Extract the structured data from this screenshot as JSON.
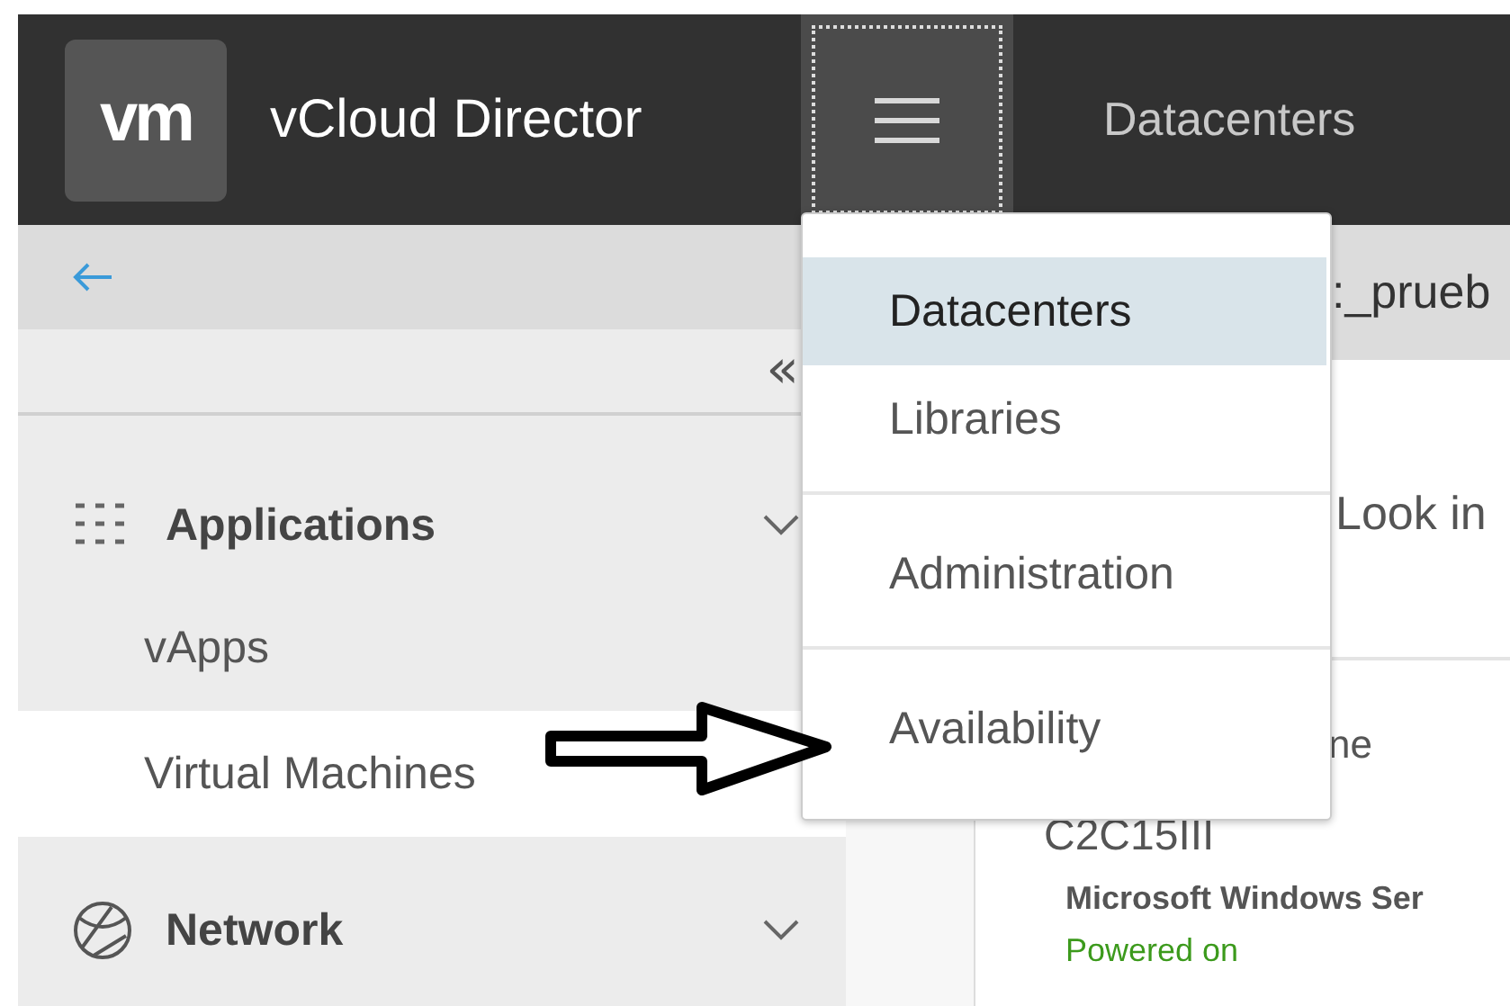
{
  "header": {
    "logo": "vm",
    "title": "vCloud Director",
    "menu_button": {
      "focused": true
    },
    "nav_link": "Datacenters"
  },
  "sidebar": {
    "collapse": "«",
    "groups": [
      {
        "label": "Applications",
        "items": [
          {
            "label": "vApps",
            "selected": false
          },
          {
            "label": "Virtual Machines",
            "selected": true
          }
        ]
      },
      {
        "label": "Network"
      }
    ]
  },
  "menu": {
    "sections": [
      [
        {
          "label": "Datacenters",
          "selected": true
        },
        {
          "label": "Libraries",
          "selected": false
        }
      ],
      [
        {
          "label": "Administration",
          "selected": false
        }
      ],
      [
        {
          "label": "Availability",
          "selected": false
        }
      ]
    ]
  },
  "content": {
    "breadcrumb": ":_prueb",
    "filter_text": "Look in",
    "column_label": "ne",
    "vm": {
      "name": "C2C15III",
      "os": "Microsoft Windows Ser",
      "status": "Powered on"
    }
  }
}
